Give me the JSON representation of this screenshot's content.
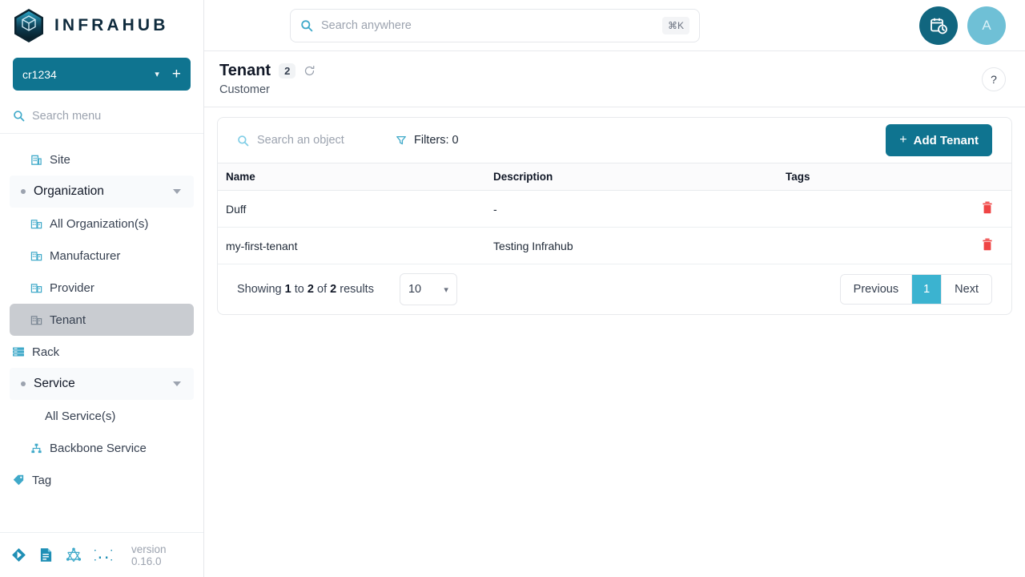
{
  "brand": {
    "name": "INFRAHUB",
    "logo_icon": "infrahub-hexagon-cube-logo"
  },
  "branch": {
    "name": "cr1234",
    "caret_icon": "chevron-down-icon",
    "add_icon": "plus-icon"
  },
  "menu_search": {
    "placeholder": "Search menu",
    "value": "",
    "icon": "search-icon"
  },
  "sidebar": {
    "items": [
      {
        "label": "Site",
        "icon": "building-icon",
        "type": "sub",
        "active": false
      },
      {
        "label": "Organization",
        "icon": "bullet-dot-icon",
        "type": "group",
        "expanded": true
      },
      {
        "label": "All Organization(s)",
        "icon": "organization-icon",
        "type": "sub",
        "active": false
      },
      {
        "label": "Manufacturer",
        "icon": "organization-icon",
        "type": "sub",
        "active": false
      },
      {
        "label": "Provider",
        "icon": "organization-icon",
        "type": "sub",
        "active": false
      },
      {
        "label": "Tenant",
        "icon": "organization-icon",
        "type": "sub",
        "active": true
      },
      {
        "label": "Rack",
        "icon": "rack-icon",
        "type": "item",
        "active": false
      },
      {
        "label": "Service",
        "icon": "bullet-dot-icon",
        "type": "group",
        "expanded": true
      },
      {
        "label": "All Service(s)",
        "icon": "none",
        "type": "sub-noicon",
        "active": false
      },
      {
        "label": "Backbone Service",
        "icon": "hierarchy-icon",
        "type": "sub",
        "active": false
      },
      {
        "label": "Tag",
        "icon": "tag-icon",
        "type": "item",
        "active": false
      }
    ],
    "footer": {
      "version": "version 0.16.0",
      "icons": [
        "git-branch-icon",
        "document-icon",
        "graphql-icon",
        "json-braces-icon"
      ]
    }
  },
  "topbar": {
    "search": {
      "placeholder": "Search anywhere",
      "value": "",
      "icon": "search-icon",
      "shortcut": "⌘K"
    },
    "time_travel_icon": "calendar-clock-icon",
    "user_avatar_initial": "A"
  },
  "page": {
    "title": "Tenant",
    "count": "2",
    "refresh_icon": "refresh-icon",
    "subtitle": "Customer",
    "help_label": "?"
  },
  "toolbar": {
    "object_search": {
      "placeholder": "Search an object",
      "value": "",
      "icon": "search-icon"
    },
    "filters_label": "Filters: 0",
    "filters_icon": "filter-icon",
    "add_button": {
      "label": "Add Tenant",
      "plus": "+"
    }
  },
  "table": {
    "columns": [
      "Name",
      "Description",
      "Tags"
    ],
    "rows": [
      {
        "name": "Duff",
        "description": "-",
        "tags": "",
        "delete_icon": "trash-icon"
      },
      {
        "name": "my-first-tenant",
        "description": "Testing Infrahub",
        "tags": "",
        "delete_icon": "trash-icon"
      }
    ]
  },
  "pagination": {
    "showing_prefix": "Showing",
    "from": "1",
    "to_word": "to",
    "to": "2",
    "of_word": "of",
    "total": "2",
    "results_word": "results",
    "page_size": "10",
    "page_size_caret": "chevron-down-icon",
    "previous_label": "Previous",
    "current_page": "1",
    "next_label": "Next"
  },
  "colors": {
    "brand_teal": "#0f7490",
    "accent_cyan": "#3bb3d0",
    "avatar_light": "#6fc0d6",
    "danger_red": "#ef4444",
    "icon_blue": "#3fa9c9"
  }
}
